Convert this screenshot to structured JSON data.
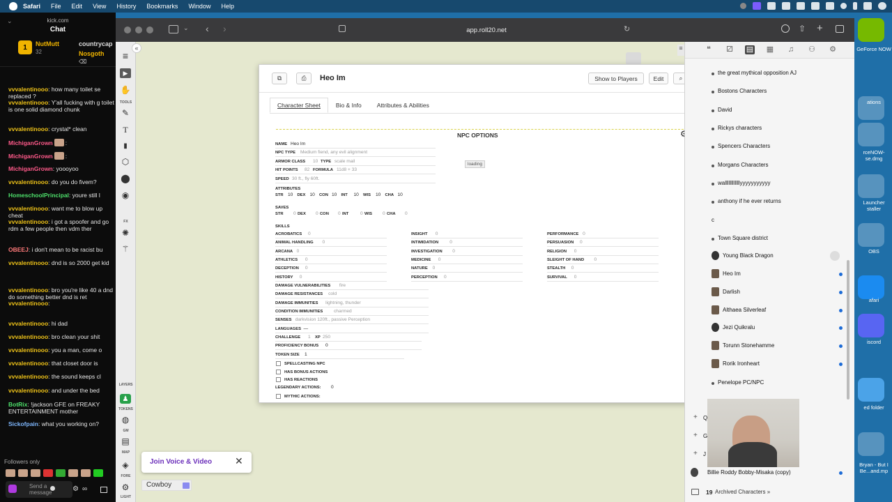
{
  "menubar": {
    "app": "Safari",
    "items": [
      "File",
      "Edit",
      "View",
      "History",
      "Bookmarks",
      "Window",
      "Help"
    ]
  },
  "chat": {
    "site": "kick.com",
    "title": "Chat",
    "users": [
      {
        "name": "NutMutt",
        "sub": "32",
        "badge": "1"
      },
      {
        "name": "countrycap"
      },
      {
        "name": "Nosgoth"
      }
    ],
    "messages": [
      {
        "user": "vvvalentinooo",
        "text": ": how many toilet se replaced ?",
        "color": "#f0c419"
      },
      {
        "user": "vvvalentinooo",
        "text": ": Y'all fucking with g toilet is one solid diamond chunk",
        "color": "#f0c419"
      },
      {
        "user": "vvvalentinooo",
        "text": ": crystal* clean",
        "color": "#f0c419"
      },
      {
        "user": "MichiganGrown",
        "text": ":",
        "color": "#ff5a8a"
      },
      {
        "user": "MichiganGrown",
        "text": ":",
        "color": "#ff5a8a"
      },
      {
        "user": "MichiganGrown",
        "text": ": yoooyoo",
        "color": "#ff5a8a"
      },
      {
        "user": "vvvalentinooo",
        "text": ": do you do fivem?",
        "color": "#f0c419"
      },
      {
        "user": "HomeschoolPrincipal",
        "text": ": youre still l",
        "color": "#4ee06b"
      },
      {
        "user": "vvvalentinooo",
        "text": ": want me to blow up cheat",
        "color": "#f0c419"
      },
      {
        "user": "vvvalentinooo",
        "text": ": i got a spoofer and go rdm a few people then vdm ther",
        "color": "#f0c419"
      },
      {
        "user": "OBEEJ",
        "text": ": i don't mean to be racist bu",
        "color": "#ff7a7a"
      },
      {
        "user": "vvvalentinooo",
        "text": ": dnd is so 2000 get kid",
        "color": "#f0c419"
      },
      {
        "user": "vvvalentinooo",
        "text": ": bro you're like 40 a dnd do something better dnd is ret",
        "color": "#f0c419"
      },
      {
        "user": "vvvalentinooo",
        "text": ":",
        "color": "#f0c419"
      },
      {
        "user": "vvvalentinooo",
        "text": ": hi dad",
        "color": "#f0c419"
      },
      {
        "user": "vvvalentinooo",
        "text": ": bro clean your shit",
        "color": "#f0c419"
      },
      {
        "user": "vvvalentinooo",
        "text": ": you a man, come o",
        "color": "#f0c419"
      },
      {
        "user": "vvvalentinooo",
        "text": ": that closet door is",
        "color": "#f0c419"
      },
      {
        "user": "vvvalentinooo",
        "text": ": the sound keeps cl",
        "color": "#f0c419"
      },
      {
        "user": "vvvalentinooo",
        "text": ": and under the bed",
        "color": "#f0c419"
      },
      {
        "user": "BotRix",
        "text": ": !jackson GFE on FREAKY ENTERTAINMENT mother",
        "color": "#4ee06b"
      },
      {
        "user": "Sickofpain",
        "text": ": what you working on?",
        "color": "#7fb8ff"
      }
    ],
    "followers_only": "Followers only",
    "send_placeholder": "Send a message"
  },
  "browser": {
    "url": "app.roll20.net"
  },
  "tools": {
    "labels": [
      "TOOLS",
      "FX",
      "LAYERS",
      "TOKENS",
      "GM",
      "MAP",
      "FORE",
      "LIGHT"
    ]
  },
  "dialog": {
    "title": "Heo Im",
    "buttons": {
      "show": "Show to Players",
      "edit": "Edit"
    },
    "tabs": [
      "Character Sheet",
      "Bio & Info",
      "Attributes & Abilities"
    ],
    "npc_options": "NPC OPTIONS",
    "loading": "loading",
    "fields": {
      "name_label": "NAME",
      "name": "Heo Im",
      "type_label": "NPC TYPE",
      "type": "Medium fiend, any evil alignment",
      "ac_label": "ARMOR CLASS",
      "ac": "10",
      "actype_label": "TYPE",
      "actype": "scale mail",
      "hp_label": "HIT POINTS",
      "hp": "82",
      "formula_label": "FORMULA",
      "formula": "11d8 + 33",
      "speed_label": "SPEED",
      "speed": "30 ft., fly 60ft.",
      "attributes_label": "ATTRIBUTES",
      "saves_label": "SAVES",
      "skills_label": "SKILLS"
    },
    "attributes": [
      {
        "k": "STR",
        "v": "10"
      },
      {
        "k": "DEX",
        "v": "10"
      },
      {
        "k": "CON",
        "v": "10"
      },
      {
        "k": "INT",
        "v": "10"
      },
      {
        "k": "WIS",
        "v": "10"
      },
      {
        "k": "CHA",
        "v": "10"
      }
    ],
    "saves": [
      {
        "k": "STR",
        "v": "0"
      },
      {
        "k": "DEX",
        "v": "0"
      },
      {
        "k": "CON",
        "v": "0"
      },
      {
        "k": "INT",
        "v": "0"
      },
      {
        "k": "WIS",
        "v": "0"
      },
      {
        "k": "CHA",
        "v": "0"
      }
    ],
    "skills_col1": [
      {
        "k": "ACROBATICS",
        "v": "0"
      },
      {
        "k": "ANIMAL HANDLING",
        "v": "0"
      },
      {
        "k": "ARCANA",
        "v": "0"
      },
      {
        "k": "ATHLETICS",
        "v": "0"
      },
      {
        "k": "DECEPTION",
        "v": "0"
      },
      {
        "k": "HISTORY",
        "v": "0"
      }
    ],
    "skills_col2": [
      {
        "k": "INSIGHT",
        "v": "0"
      },
      {
        "k": "INTIMIDATION",
        "v": "0"
      },
      {
        "k": "INVESTIGATION",
        "v": "0"
      },
      {
        "k": "MEDICINE",
        "v": "0"
      },
      {
        "k": "NATURE",
        "v": "0"
      },
      {
        "k": "PERCEPTION",
        "v": "0"
      }
    ],
    "skills_col3": [
      {
        "k": "PERFORMANCE",
        "v": "0"
      },
      {
        "k": "PERSUASION",
        "v": "0"
      },
      {
        "k": "RELIGION",
        "v": "0"
      },
      {
        "k": "SLEIGHT OF HAND",
        "v": "0"
      },
      {
        "k": "STEALTH",
        "v": "0"
      },
      {
        "k": "SURVIVAL",
        "v": "0"
      }
    ],
    "traits": [
      {
        "k": "DAMAGE VULNERABILITIES",
        "v": "fire"
      },
      {
        "k": "DAMAGE RESISTANCES",
        "v": "cold"
      },
      {
        "k": "DAMAGE IMMUNITIES",
        "v": "lightning, thunder"
      },
      {
        "k": "CONDITION IMMUNITIES",
        "v": "charmed"
      },
      {
        "k": "SENSES",
        "v": "darkvision 120ft., passive Perception"
      },
      {
        "k": "LANGUAGES",
        "v": "—"
      }
    ],
    "challenge_label": "CHALLENGE",
    "challenge": "1",
    "xp_label": "XP",
    "xp": "250",
    "prof_label": "PROFICIENCY BONUS",
    "prof": "0",
    "token_label": "TOKEN SIZE",
    "token": "1",
    "checks": [
      "SPELLCASTING NPC",
      "HAS BONUS ACTIONS",
      "HAS REACTIONS"
    ],
    "legendary_label": "LEGENDARY ACTIONS:",
    "legendary": "0",
    "mythic_label": "MYTHIC ACTIONS:"
  },
  "journal": {
    "folders": [
      "the great mythical opposition AJ",
      "Bostons Characters",
      "David",
      "Rickys characters",
      "Spencers Characters",
      "Morgans Characters",
      "wallllllllllllyyyyyyyyyyy",
      "anthony if he ever returns",
      "c",
      "Town Square district"
    ],
    "characters": [
      "Young Black Dragon",
      "Heo Im",
      "Darlish",
      "Althaea Silverleaf",
      "Jezi Quikralu",
      "Torunn Stonehamme",
      "Rorik Ironheart"
    ],
    "penelope": "Penelope PC/NPC",
    "collapsed": [
      "Q",
      "G",
      "J"
    ],
    "billie": "Billie Roddy Bobby-Misaka (copy)",
    "archived_count": "19",
    "archived_label": "Archived Characters »"
  },
  "voice": {
    "join_label": "Join Voice & Video",
    "player": "Cowboy"
  },
  "desktop": {
    "labels": [
      "GeForce NOW",
      "ations",
      "rceNOW-se.dmg",
      "Launcher staller",
      "OBS",
      "afari",
      "iscord",
      "ed folder",
      "Bryan - But I Be...and.mp"
    ]
  }
}
